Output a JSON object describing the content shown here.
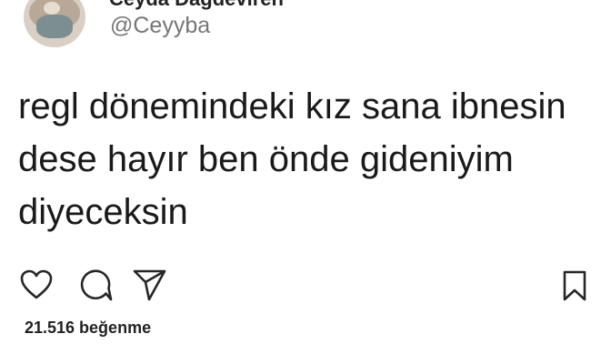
{
  "profile": {
    "display_name": "Ceyda Dağdeviren",
    "handle": "@Ceyyba"
  },
  "tweet": {
    "lines": [
      "regl dönemindeki kız sana ibnesin",
      "dese hayır ben önde gideniyim",
      "diyeceksin"
    ]
  },
  "actions": {
    "icons": [
      "heart-icon",
      "comment-icon",
      "share-icon",
      "bookmark-icon"
    ]
  },
  "stats": {
    "likes_text": "21.516 beğenme"
  },
  "colors": {
    "text": "#1a1a1a",
    "handle": "#777777",
    "icon": "#262626",
    "background": "#ffffff"
  }
}
